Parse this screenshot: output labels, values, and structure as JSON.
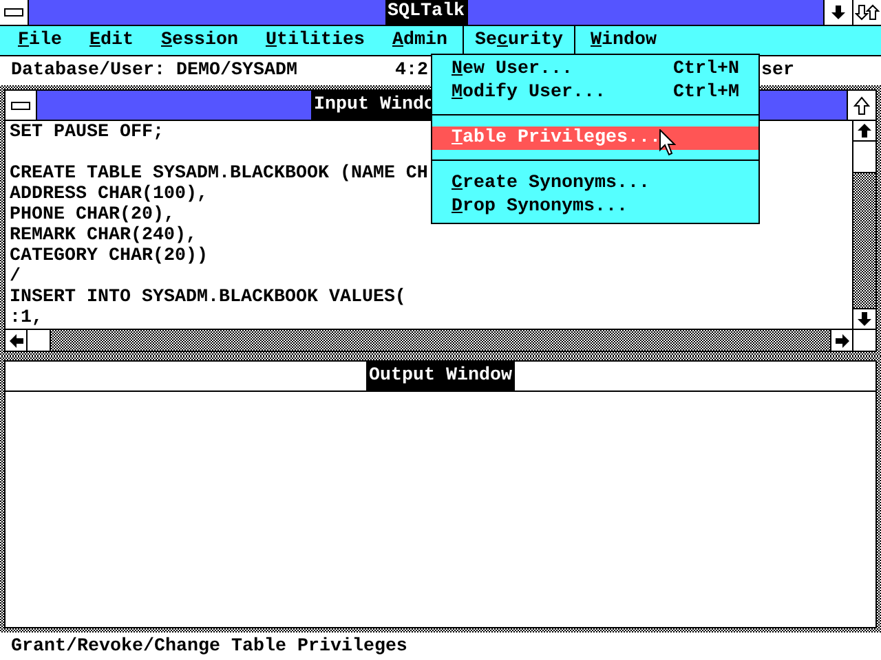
{
  "window": {
    "title": "SQLTalk"
  },
  "menu_bar": [
    {
      "key": "F",
      "rest": "ile",
      "selected": false
    },
    {
      "key": "E",
      "rest": "dit",
      "selected": false
    },
    {
      "key": "S",
      "rest": "ession",
      "selected": false
    },
    {
      "key": "U",
      "rest": "tilities",
      "selected": false
    },
    {
      "key": "A",
      "rest": "dmin",
      "selected": false
    },
    {
      "prefix": "Se",
      "key": "c",
      "rest": "urity",
      "selected": true
    },
    {
      "key": "W",
      "rest": "indow",
      "selected": false
    }
  ],
  "info_bar": {
    "database_user": "Database/User: DEMO/SYSADM",
    "column_2": "4:2",
    "column_3": "ser"
  },
  "security_menu": [
    {
      "kind": "item",
      "key": "N",
      "rest": "ew User...",
      "shortcut": "Ctrl+N",
      "selected": false
    },
    {
      "kind": "item",
      "key": "M",
      "rest": "odify User...",
      "shortcut": "Ctrl+M",
      "selected": false
    },
    {
      "kind": "separator"
    },
    {
      "kind": "item",
      "key": "T",
      "rest": "able Privileges...",
      "selected": true
    },
    {
      "kind": "separator"
    },
    {
      "kind": "item",
      "key": "C",
      "rest": "reate Synonyms...",
      "selected": false
    },
    {
      "kind": "item",
      "key": "D",
      "rest": "rop Synonyms...",
      "selected": false
    }
  ],
  "input_window": {
    "title": "Input Windo",
    "lines": [
      {
        "kind": "text",
        "text": "SET PAUSE OFF;"
      },
      {
        "kind": "blank"
      },
      {
        "kind": "text",
        "text": "CREATE TABLE SYSADM.BLACKBOOK (NAME CH"
      },
      {
        "kind": "text",
        "text": "ADDRESS CHAR(100),"
      },
      {
        "kind": "text",
        "text": "PHONE CHAR(20),"
      },
      {
        "kind": "text",
        "text": "REMARK CHAR(240),"
      },
      {
        "kind": "text",
        "text": "CATEGORY CHAR(20))"
      },
      {
        "kind": "text",
        "text": "/"
      },
      {
        "kind": "text",
        "text": "INSERT INTO SYSADM.BLACKBOOK VALUES("
      },
      {
        "kind": "text",
        "text": ":1,"
      }
    ]
  },
  "output_window": {
    "title": "Output Window"
  },
  "status_bar": "Grant/Revoke/Change Table Privileges"
}
